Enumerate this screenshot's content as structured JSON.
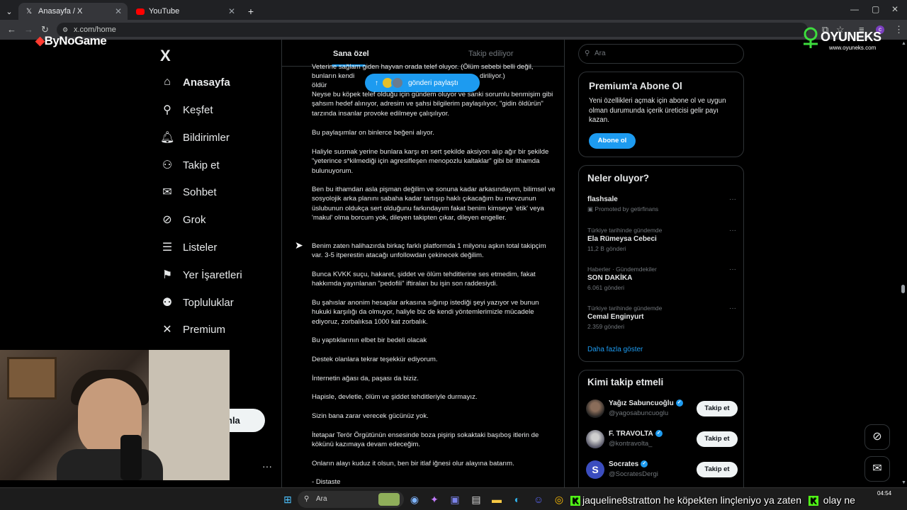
{
  "browser": {
    "tabs": [
      {
        "title": "Anasayfa / X",
        "active": true
      },
      {
        "title": "YouTube",
        "active": false
      }
    ],
    "url": "x.com/home",
    "tab_close": "✕",
    "new_tab": "+"
  },
  "overlays": {
    "left_logo": "ByNoGame",
    "right_logo": "OYUNEKS",
    "right_logo_sub": "www.oyuneks.com"
  },
  "sidebar": {
    "logo": "X",
    "items": [
      {
        "label": "Anasayfa",
        "icon": "home-icon"
      },
      {
        "label": "Keşfet",
        "icon": "search-icon"
      },
      {
        "label": "Bildirimler",
        "icon": "bell-icon"
      },
      {
        "label": "Takip et",
        "icon": "add-user-icon"
      },
      {
        "label": "Sohbet",
        "icon": "mail-icon"
      },
      {
        "label": "Grok",
        "icon": "grok-icon"
      },
      {
        "label": "Listeler",
        "icon": "list-icon"
      },
      {
        "label": "Yer İşaretleri",
        "icon": "bookmark-icon"
      },
      {
        "label": "Topluluklar",
        "icon": "people-icon"
      },
      {
        "label": "Premium",
        "icon": "x-premium-icon"
      }
    ],
    "post_button_fragment": "nla",
    "more": "···"
  },
  "timeline": {
    "tabs": [
      "Sana özel",
      "Takip ediliyor"
    ],
    "share_pill": "gönderi paylaştı",
    "paragraphs": [
      "Veterine sağlam giden hayvan orada telef oluyor. (Ölüm sebebi belli değil,",
      "bunların kendi öldür",
      "diriliyor.)",
      "Neyse bu köpek telef olduğu için gündem oluyor ve sanki sorumlu benmişim gibi şahsım hedef alınıyor, adresim ve şahsi bilgilerim paylaşılıyor, \"gidin öldürün\" tarzında insanlar provoke edilmeye çalışılıyor.",
      "Bu paylaşımlar on binlerce beğeni alıyor.",
      "Haliyle susmak yerine bunlara karşı en sert şekilde aksiyon alıp ağır bir şekilde \"yeterince s*kilmediği için agresifleşen menopozlu kaltaklar\" gibi bir ithamda bulunuyorum.",
      "Ben bu ithamdan asla pişman değilim ve sonuna kadar arkasındayım, bilimsel ve sosyolojik arka planını sabaha kadar tartışıp haklı çıkacağım bu mevzunun üslubunun oldukça sert olduğunu farkındayım fakat benim kimseye 'etik' veya 'makul' olma borcum yok, dileyen takipten çıkar, dileyen engeller.",
      "Benim zaten halihazırda birkaç farklı platformda 1 milyonu aşkın total takipçim var. 3-5 itperestin atacağı unfollowdan çekinecek değilim.",
      "Bunca KVKK suçu, hakaret, şiddet ve ölüm tehditlerine ses etmedim, fakat hakkımda yayınlanan \"pedofili\" iftiraları bu işin son raddesiydi.",
      "Bu şahıslar anonim hesaplar arkasına sığınıp istediği şeyi yazıyor ve bunun hukuki karşılığı da olmuyor, haliyle biz de kendi yöntemlerimizle mücadele ediyoruz, zorbalıksa 1000 kat zorbalık.",
      "Bu yaptıklarının elbet bir bedeli olacak",
      "Destek olanlara tekrar teşekkür ediyorum.",
      "İnternetin ağası da, paşası da biziz.",
      "Hapisle, devletle, ölüm ve şiddet tehditleriyle durmayız.",
      "Sizin bana zarar verecek gücünüz yok.",
      "İtetapar Terör Örgütünün ensesinde boza pişirip sokaktaki başıboş itlerin de kökünü kazımaya devam edeceğim.",
      "Onların alayı kuduz it olsun, ben bir itlaf iğnesi olur alayına batarım.",
      "- Distaste"
    ]
  },
  "right": {
    "search_placeholder": "Ara",
    "premium": {
      "title": "Premium'a Abone Ol",
      "desc": "Yeni özellikleri açmak için abone ol ve uygun olman durumunda içerik üreticisi gelir payı kazan.",
      "button": "Abone ol"
    },
    "trends": {
      "title": "Neler oluyor?",
      "items": [
        {
          "meta": "",
          "name": "flashsale",
          "sub": "Promoted by getirfinans"
        },
        {
          "meta": "Türkiye tarihinde gündemde",
          "name": "Ela Rümeysa Cebeci",
          "sub": "11,2 B gönderi"
        },
        {
          "meta": "Haberler · Gündemdekiler",
          "name": "SON DAKİKA",
          "sub": "6.061 gönderi"
        },
        {
          "meta": "Türkiye tarihinde gündemde",
          "name": "Cemal Enginyurt",
          "sub": "2.359 gönderi"
        }
      ],
      "show_more": "Daha fazla göster",
      "dots": "···"
    },
    "who_to_follow": {
      "title": "Kimi takip etmeli",
      "items": [
        {
          "name": "Yağız Sabuncuoğlu",
          "handle": "@yagosabuncuoglu",
          "button": "Takip et"
        },
        {
          "name": "F. TRAVOLTA",
          "handle": "@kontravolta_",
          "button": "Takip et"
        },
        {
          "name": "Socrates",
          "handle": "@SocratesDergi",
          "button": "Takip et"
        }
      ]
    }
  },
  "taskbar": {
    "search": "Ara",
    "chat_user": "jaqueline8stratton",
    "chat_message": "he köpekten linçleniyo ya zaten",
    "chat_tail": "olay ne",
    "time": "04:54"
  },
  "colors": {
    "accent": "#1d9bf0",
    "background": "#000000",
    "border": "#2f3336",
    "muted": "#71767b",
    "kick_green": "#53fc18"
  }
}
